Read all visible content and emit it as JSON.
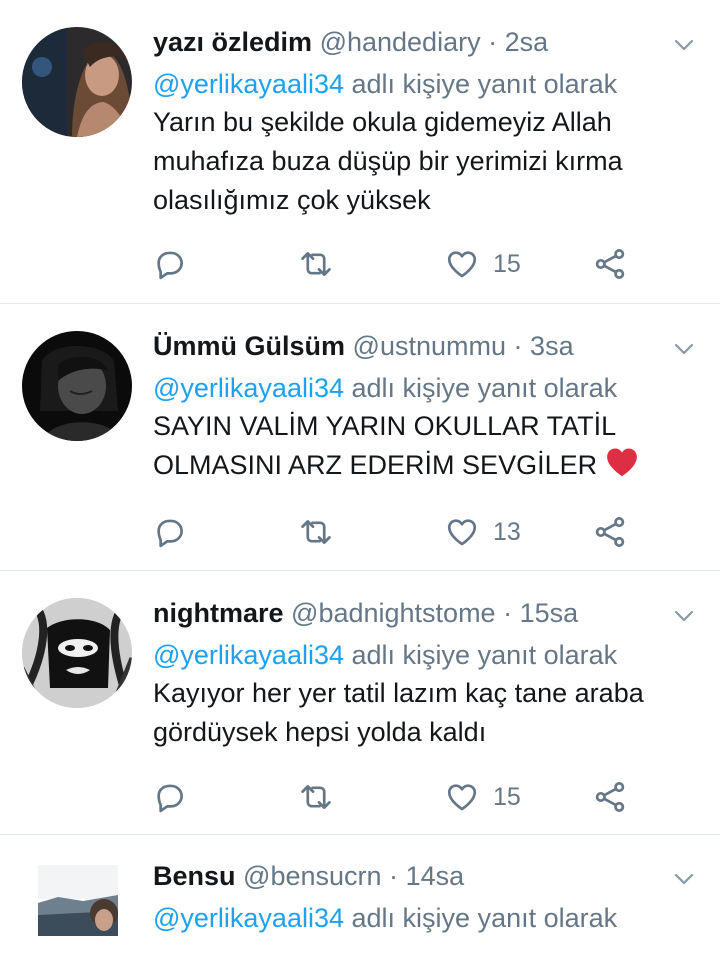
{
  "reply_prefix": "adlı kişiye yanıt olarak",
  "tweets": [
    {
      "name": "yazı özledim",
      "handle": "@handediary",
      "separator": "·",
      "time": "2sa",
      "mention": "@yerlikayaali34",
      "text_lines": [
        "Yarın bu şekilde okula gidemeyiz Allah",
        "muhafıza buza düşüp bir yerimizi kırma",
        "olasılığımız çok yüksek"
      ],
      "likes": "15"
    },
    {
      "name": "Ümmü Gülsüm",
      "handle": "@ustnummu",
      "separator": "·",
      "time": "3sa",
      "mention": "@yerlikayaali34",
      "text_lines": [
        "SAYIN VALİM YARIN OKULLAR TATİL",
        "OLMASINI ARZ EDERİM SEVGİLER"
      ],
      "likes": "13"
    },
    {
      "name": "nightmare",
      "handle": "@badnightstome",
      "separator": "·",
      "time": "15sa",
      "mention": "@yerlikayaali34",
      "text_lines": [
        "Kayıyor her yer tatil lazım kaç tane araba",
        "gördüysek hepsi yolda kaldı"
      ],
      "likes": "15"
    },
    {
      "name": "Bensu",
      "handle": "@bensucrn",
      "separator": "·",
      "time": "14sa",
      "mention": "@yerlikayaali34"
    }
  ],
  "icons": {
    "reply": "reply-icon",
    "retweet": "retweet-icon",
    "like": "heart-outline-icon",
    "share": "share-icon",
    "more": "chevron-down-icon",
    "emoji": "red-heart-emoji"
  },
  "colors": {
    "link": "#1da1f2",
    "secondary": "#657786",
    "text": "#14171a",
    "divider": "#e1e8ed",
    "emoji_heart": "#dd2e44"
  }
}
